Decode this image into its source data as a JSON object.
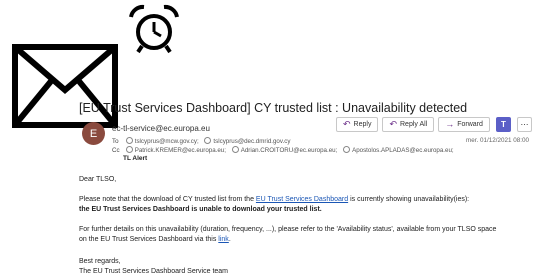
{
  "email": {
    "subject": "[EU Trust Services Dashboard] CY trusted list : Unavailability detected",
    "avatar_initial": "E",
    "sender": "ec-tl-service@ec.europa.eu",
    "to_label": "To",
    "to": [
      "tslcyprus@mcw.gov.cy;",
      "tslcyprus@dec.dmrid.gov.cy"
    ],
    "cc_label": "Cc",
    "cc": [
      "Patrick.KREMER@ec.europa.eu;",
      "Adrian.CROITORU@ec.europa.eu;",
      "Apostolos.APLADAS@ec.europa.eu;"
    ],
    "tag": "TL Alert",
    "date": "mer. 01/12/2021 08:00",
    "actions": {
      "reply": "Reply",
      "reply_all": "Reply All",
      "forward": "Forward"
    },
    "body": {
      "greeting": "Dear TLSO,",
      "p1_before": "Please note that the download of CY trusted list from the ",
      "p1_link": "EU Trust Services Dashboard",
      "p1_after": " is currently showing unavailability(ies):",
      "p1_bold": "the EU Trust Services Dashboard is unable to download your trusted list.",
      "p2_line1": "For further details on this unavailability (duration, frequency, ...), please refer to the 'Availability status', available from your TLSO space",
      "p2_before": "on the EU Trust Services Dashboard via this ",
      "p2_link": "link",
      "p2_after": ".",
      "closing": "Best regards,",
      "signature": "The EU Trust Services Dashboard Service team"
    }
  },
  "icons": {
    "alarm": "alarm-clock-icon",
    "mail": "envelope-icon",
    "reply": "reply-icon",
    "reply_all": "reply-all-icon",
    "forward": "forward-icon",
    "teams": "teams-icon",
    "more": "more-icon",
    "person": "person-icon"
  },
  "colors": {
    "link": "#1a56b5",
    "avatar": "#8a4a3e",
    "action_icon": "#6b2f89",
    "teams": "#5b5fc7"
  }
}
